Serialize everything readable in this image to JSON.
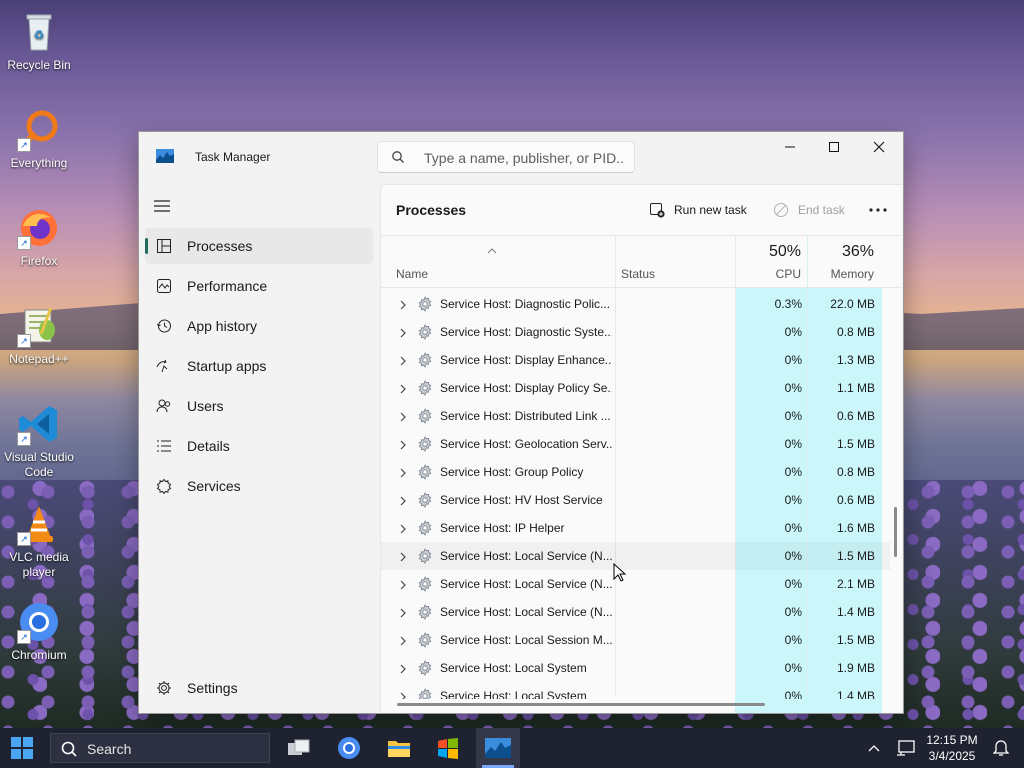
{
  "desktop": {
    "icons": [
      {
        "label": "Recycle Bin",
        "icon": "recycle-bin-icon"
      },
      {
        "label": "Everything",
        "icon": "everything-search-icon"
      },
      {
        "label": "Firefox",
        "icon": "firefox-icon"
      },
      {
        "label": "Notepad++",
        "icon": "notepad-plus-plus-icon"
      },
      {
        "label": "Visual Studio Code",
        "icon": "vscode-icon"
      },
      {
        "label": "VLC media player",
        "icon": "vlc-icon"
      },
      {
        "label": "Chromium",
        "icon": "chromium-icon"
      }
    ]
  },
  "window": {
    "title": "Task Manager",
    "search_placeholder": "Type a name, publisher, or PID..."
  },
  "nav": {
    "items": [
      {
        "label": "Processes",
        "icon": "processes-icon",
        "active": true
      },
      {
        "label": "Performance",
        "icon": "performance-icon"
      },
      {
        "label": "App history",
        "icon": "app-history-icon"
      },
      {
        "label": "Startup apps",
        "icon": "startup-apps-icon"
      },
      {
        "label": "Users",
        "icon": "users-icon"
      },
      {
        "label": "Details",
        "icon": "details-icon"
      },
      {
        "label": "Services",
        "icon": "services-icon"
      }
    ],
    "settings": "Settings"
  },
  "commandbar": {
    "title": "Processes",
    "run_new_task": "Run new task",
    "end_task": "End task"
  },
  "table": {
    "columns": {
      "name": "Name",
      "status": "Status",
      "cpu": "CPU",
      "memory": "Memory",
      "cpu_pct": "50%",
      "memory_pct": "36%"
    },
    "rows": [
      {
        "name": "Service Host: Diagnostic Polic...",
        "status": "",
        "cpu": "0.3%",
        "memory": "22.0 MB"
      },
      {
        "name": "Service Host: Diagnostic Syste...",
        "status": "",
        "cpu": "0%",
        "memory": "0.8 MB"
      },
      {
        "name": "Service Host: Display Enhance...",
        "status": "",
        "cpu": "0%",
        "memory": "1.3 MB"
      },
      {
        "name": "Service Host: Display Policy Se...",
        "status": "",
        "cpu": "0%",
        "memory": "1.1 MB"
      },
      {
        "name": "Service Host: Distributed Link ...",
        "status": "",
        "cpu": "0%",
        "memory": "0.6 MB"
      },
      {
        "name": "Service Host: Geolocation Serv...",
        "status": "",
        "cpu": "0%",
        "memory": "1.5 MB"
      },
      {
        "name": "Service Host: Group Policy",
        "status": "",
        "cpu": "0%",
        "memory": "0.8 MB"
      },
      {
        "name": "Service Host: HV Host Service",
        "status": "",
        "cpu": "0%",
        "memory": "0.6 MB"
      },
      {
        "name": "Service Host: IP Helper",
        "status": "",
        "cpu": "0%",
        "memory": "1.6 MB"
      },
      {
        "name": "Service Host: Local Service (N...",
        "status": "",
        "cpu": "0%",
        "memory": "1.5 MB",
        "hover": true
      },
      {
        "name": "Service Host: Local Service (N...",
        "status": "",
        "cpu": "0%",
        "memory": "2.1 MB"
      },
      {
        "name": "Service Host: Local Service (N...",
        "status": "",
        "cpu": "0%",
        "memory": "1.4 MB"
      },
      {
        "name": "Service Host: Local Session M...",
        "status": "",
        "cpu": "0%",
        "memory": "1.5 MB"
      },
      {
        "name": "Service Host: Local System",
        "status": "",
        "cpu": "0%",
        "memory": "1.9 MB"
      },
      {
        "name": "Service Host: Local System",
        "status": "",
        "cpu": "0%",
        "memory": "1.4 MB"
      }
    ]
  },
  "taskbar": {
    "search_label": "Search",
    "apps": [
      "task-view-icon",
      "chromium-icon",
      "file-explorer-icon",
      "windows-logo-app-icon",
      "task-manager-icon"
    ],
    "time": "12:15 PM",
    "date": "3/4/2025"
  }
}
